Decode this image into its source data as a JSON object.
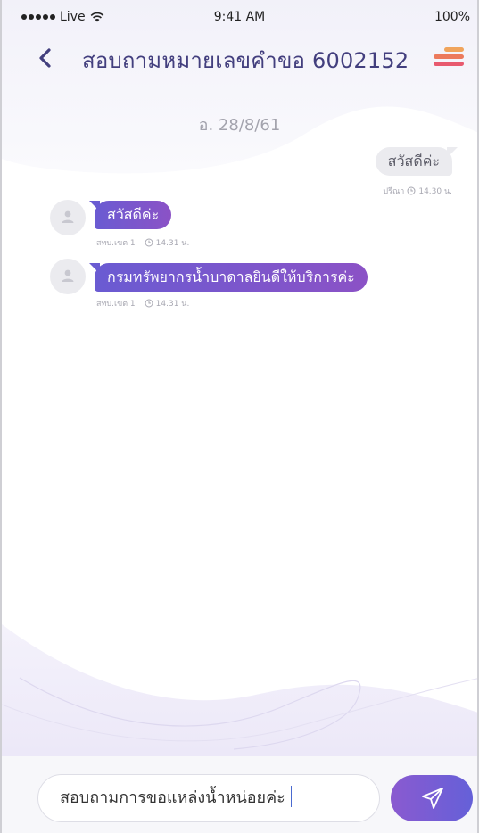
{
  "status_bar": {
    "carrier": "Live",
    "time": "9:41 AM",
    "battery": "100%"
  },
  "header": {
    "title": "สอบถามหมายเลขคำขอ 6002152",
    "back_icon": "chevron-left-icon",
    "menu_icon": "hamburger-menu-icon"
  },
  "chat": {
    "date": "อ. 28/8/61",
    "messages": [
      {
        "direction": "outgoing",
        "text": "สวัสดีค่ะ",
        "sender": "ปรีณา",
        "time": "14.30 น."
      },
      {
        "direction": "incoming",
        "text": "สวัสดีค่ะ",
        "sender": "สทบ.เขต 1",
        "time": "14.31 น."
      },
      {
        "direction": "incoming",
        "text": "กรมทรัพยากรน้ำบาดาลยินดีให้บริการค่ะ",
        "sender": "สทบ.เขต 1",
        "time": "14.31 น."
      }
    ]
  },
  "composer": {
    "value": "สอบถามการขอแหล่งน้ำหน่อยค่ะ",
    "send_icon": "paper-plane-icon"
  },
  "colors": {
    "title": "#433f7e",
    "bubble_in_start": "#6a5bd2",
    "bubble_in_end": "#8b52c6",
    "bubble_out": "#ebebef",
    "menu_orange": "#f0a45c",
    "menu_red": "#e8596e"
  }
}
